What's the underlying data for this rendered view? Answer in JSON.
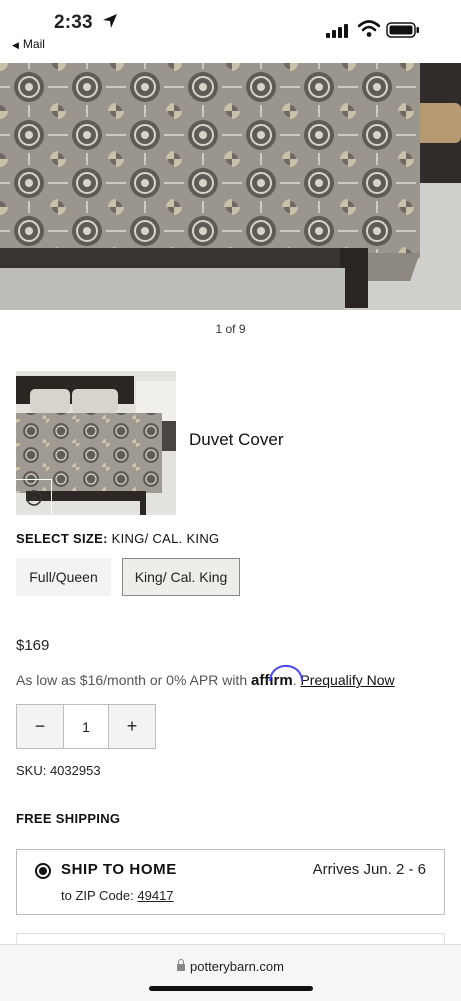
{
  "status_bar": {
    "time": "2:33",
    "back_label": "Mail"
  },
  "gallery": {
    "pager": "1 of 9"
  },
  "product": {
    "title": "Duvet Cover",
    "select_size_label": "SELECT SIZE:",
    "selected_size": "KING/ CAL. KING",
    "sizes": [
      "Full/Queen",
      "King/ Cal. King"
    ],
    "price": "$169",
    "financing": {
      "text": "As low as $16/month or 0% APR with",
      "brand": "affirm",
      "period": ".",
      "link": "Prequalify Now"
    },
    "quantity": {
      "minus": "−",
      "value": "1",
      "plus": "+"
    },
    "sku": "SKU: 4032953"
  },
  "shipping": {
    "heading": "FREE SHIPPING",
    "option_title": "SHIP TO HOME",
    "arrives": "Arrives Jun. 2 - 6",
    "zip_label": "to ZIP Code:",
    "zip_code": "49417"
  },
  "browser": {
    "url": "potterybarn.com"
  },
  "colors": {
    "accent_affirm": "#4a4af4",
    "text": "#222222",
    "button_bg": "#f4f3f1"
  }
}
